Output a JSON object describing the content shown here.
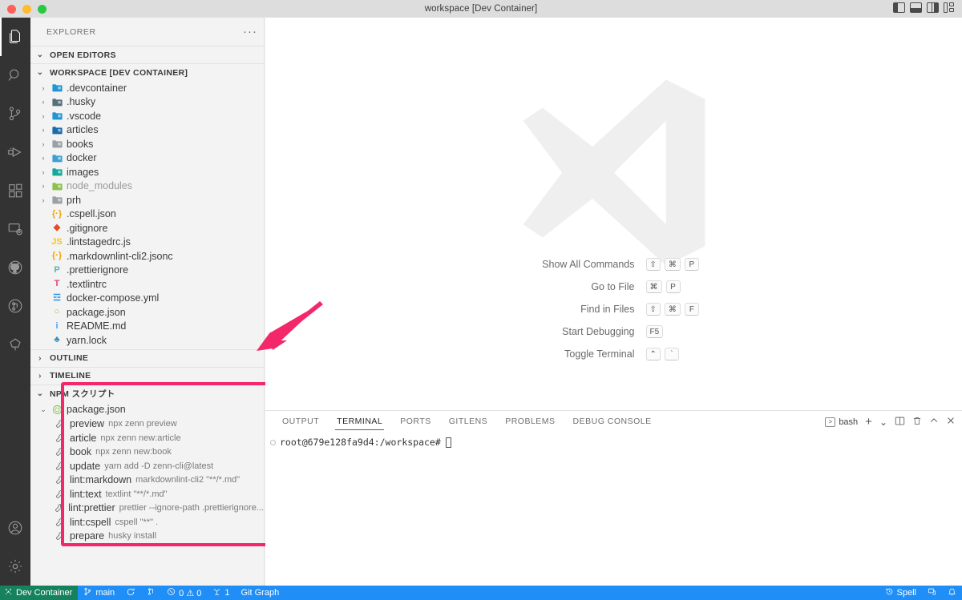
{
  "titlebar": {
    "title": "workspace [Dev Container]",
    "traffic": [
      "close",
      "minimize",
      "zoom"
    ],
    "layout_icons": [
      "toggle-primary-sidebar",
      "toggle-panel",
      "toggle-secondary-sidebar",
      "customize-layout"
    ]
  },
  "activitybar": {
    "items": [
      {
        "name": "explorer",
        "icon": "files-icon",
        "active": true
      },
      {
        "name": "search",
        "icon": "search-icon",
        "active": false
      },
      {
        "name": "source-control",
        "icon": "source-control-icon",
        "active": false
      },
      {
        "name": "run-and-debug",
        "icon": "run-debug-icon",
        "active": false
      },
      {
        "name": "extensions",
        "icon": "extensions-icon",
        "active": false
      },
      {
        "name": "remote-explorer",
        "icon": "remote-explorer-icon",
        "active": false
      },
      {
        "name": "github",
        "icon": "github-icon",
        "active": false
      },
      {
        "name": "gitlens",
        "icon": "gitlens-icon",
        "active": false
      },
      {
        "name": "git-graph",
        "icon": "tree-icon",
        "active": false
      }
    ],
    "bottom": [
      {
        "name": "accounts",
        "icon": "account-icon"
      },
      {
        "name": "settings",
        "icon": "gear-icon"
      }
    ]
  },
  "sidebar": {
    "title": "EXPLORER",
    "more_actions": "···",
    "sections": [
      {
        "label": "OPEN EDITORS",
        "expanded": false
      },
      {
        "label": "WORKSPACE [DEV CONTAINER]",
        "expanded": true
      },
      {
        "label": "OUTLINE",
        "expanded": false
      },
      {
        "label": "TIMELINE",
        "expanded": false
      },
      {
        "label": "NPM スクリプト",
        "expanded": true
      }
    ],
    "tree": [
      {
        "name": ".devcontainer",
        "type": "folder",
        "icon": "folder-devcontainer",
        "color": "#2196d3",
        "arrow": "›"
      },
      {
        "name": ".husky",
        "type": "folder",
        "icon": "folder-husky",
        "color": "#546e7a",
        "arrow": "›"
      },
      {
        "name": ".vscode",
        "type": "folder",
        "icon": "folder-vscode",
        "color": "#2196d3",
        "arrow": "›"
      },
      {
        "name": "articles",
        "type": "folder",
        "icon": "folder-articles",
        "color": "#1b6ca8",
        "arrow": "›"
      },
      {
        "name": "books",
        "type": "folder",
        "icon": "folder-books",
        "color": "#9aa0a6",
        "arrow": "›"
      },
      {
        "name": "docker",
        "type": "folder",
        "icon": "folder-docker",
        "color": "#3f9fd4",
        "arrow": "›"
      },
      {
        "name": "images",
        "type": "folder",
        "icon": "folder-images",
        "color": "#13a89e",
        "arrow": "›"
      },
      {
        "name": "node_modules",
        "type": "folder",
        "icon": "folder-node-modules",
        "color": "#8cc04f",
        "arrow": "›",
        "dim": true
      },
      {
        "name": "prh",
        "type": "folder",
        "icon": "folder-prh",
        "color": "#9aa0a6",
        "arrow": "›"
      },
      {
        "name": ".cspell.json",
        "type": "file",
        "icon": "json-icon",
        "glyph": "{·}",
        "color": "#f0a500"
      },
      {
        "name": ".gitignore",
        "type": "file",
        "icon": "git-icon",
        "glyph": "◆",
        "color": "#e44d26"
      },
      {
        "name": ".lintstagedrc.js",
        "type": "file",
        "icon": "javascript-icon",
        "glyph": "JS",
        "color": "#f5c518"
      },
      {
        "name": ".markdownlint-cli2.jsonc",
        "type": "file",
        "icon": "json-icon",
        "glyph": "{·}",
        "color": "#f0a500"
      },
      {
        "name": ".prettierignore",
        "type": "file",
        "icon": "prettier-icon",
        "glyph": "P",
        "color": "#56b3b4"
      },
      {
        "name": ".textlintrc",
        "type": "file",
        "icon": "textlint-icon",
        "glyph": "T",
        "color": "#e0457b"
      },
      {
        "name": "docker-compose.yml",
        "type": "file",
        "icon": "docker-icon",
        "glyph": "☲",
        "color": "#2496ed"
      },
      {
        "name": "package.json",
        "type": "file",
        "icon": "npm-icon",
        "glyph": "○",
        "color": "#8cc04f"
      },
      {
        "name": "README.md",
        "type": "file",
        "icon": "info-icon",
        "glyph": "i",
        "color": "#42a5f5"
      },
      {
        "name": "yarn.lock",
        "type": "file",
        "icon": "yarn-icon",
        "glyph": "♣",
        "color": "#2c8ebb"
      }
    ],
    "npm_scripts": {
      "root_label": "package.json",
      "root_icon": "npm-icon",
      "scripts": [
        {
          "name": "preview",
          "command": "npx zenn preview"
        },
        {
          "name": "article",
          "command": "npx zenn new:article"
        },
        {
          "name": "book",
          "command": "npx zenn new:book"
        },
        {
          "name": "update",
          "command": "yarn add -D zenn-cli@latest"
        },
        {
          "name": "lint:markdown",
          "command": "markdownlint-cli2 \"**/*.md\""
        },
        {
          "name": "lint:text",
          "command": "textlint \"**/*.md\""
        },
        {
          "name": "lint:prettier",
          "command": "prettier --ignore-path .prettierignore..."
        },
        {
          "name": "lint:cspell",
          "command": "cspell \"**\" ."
        },
        {
          "name": "prepare",
          "command": "husky install"
        }
      ]
    }
  },
  "editor": {
    "watermark_icon": "vscode-logo",
    "shortcuts": [
      {
        "label": "Show All Commands",
        "keys": [
          "⇧",
          "⌘",
          "P"
        ]
      },
      {
        "label": "Go to File",
        "keys": [
          "⌘",
          "P"
        ]
      },
      {
        "label": "Find in Files",
        "keys": [
          "⇧",
          "⌘",
          "F"
        ]
      },
      {
        "label": "Start Debugging",
        "keys": [
          "F5"
        ]
      },
      {
        "label": "Toggle Terminal",
        "keys": [
          "⌃",
          "`"
        ]
      }
    ]
  },
  "panel": {
    "tabs": [
      {
        "label": "OUTPUT",
        "active": false
      },
      {
        "label": "TERMINAL",
        "active": true
      },
      {
        "label": "PORTS",
        "active": false
      },
      {
        "label": "GITLENS",
        "active": false
      },
      {
        "label": "PROBLEMS",
        "active": false
      },
      {
        "label": "DEBUG CONSOLE",
        "active": false
      }
    ],
    "actions": {
      "shell_label": "bash",
      "shell_icon": "terminal-icon",
      "new_terminal": "+",
      "dropdown": "⌄",
      "split": "split-terminal-icon",
      "kill": "trash-icon",
      "maximize": "chevron-up-icon",
      "close": "close-icon"
    },
    "terminal": {
      "prompt": "root@679e128fa9d4:/workspace#",
      "cursor": true
    }
  },
  "statusbar": {
    "remote": {
      "label": "Dev Container",
      "icon": "remote-icon",
      "color": "#16825d"
    },
    "left": [
      {
        "name": "branch",
        "icon": "source-control-icon",
        "label": "main"
      },
      {
        "name": "sync",
        "icon": "sync-icon",
        "label": ""
      },
      {
        "name": "gitlens-blame",
        "icon": "gitlens-icon",
        "label": ""
      },
      {
        "name": "problems",
        "icon": "error-warning-icon",
        "label": "0 ⚠ 0"
      },
      {
        "name": "ports",
        "icon": "ports-icon",
        "label": "1"
      },
      {
        "name": "git-graph",
        "icon": "",
        "label": "Git Graph"
      }
    ],
    "right": [
      {
        "name": "spell-checker",
        "icon": "history-icon",
        "label": "Spell"
      },
      {
        "name": "live-share",
        "icon": "live-share-icon",
        "label": ""
      },
      {
        "name": "notifications",
        "icon": "bell-icon",
        "label": ""
      }
    ],
    "background": "#1f8ef7"
  },
  "annotations": {
    "arrow": {
      "color": "#f4276b",
      "direction": "down-left"
    },
    "highlight_box": {
      "color": "#f4276b",
      "target": "npm-scripts-section"
    }
  }
}
